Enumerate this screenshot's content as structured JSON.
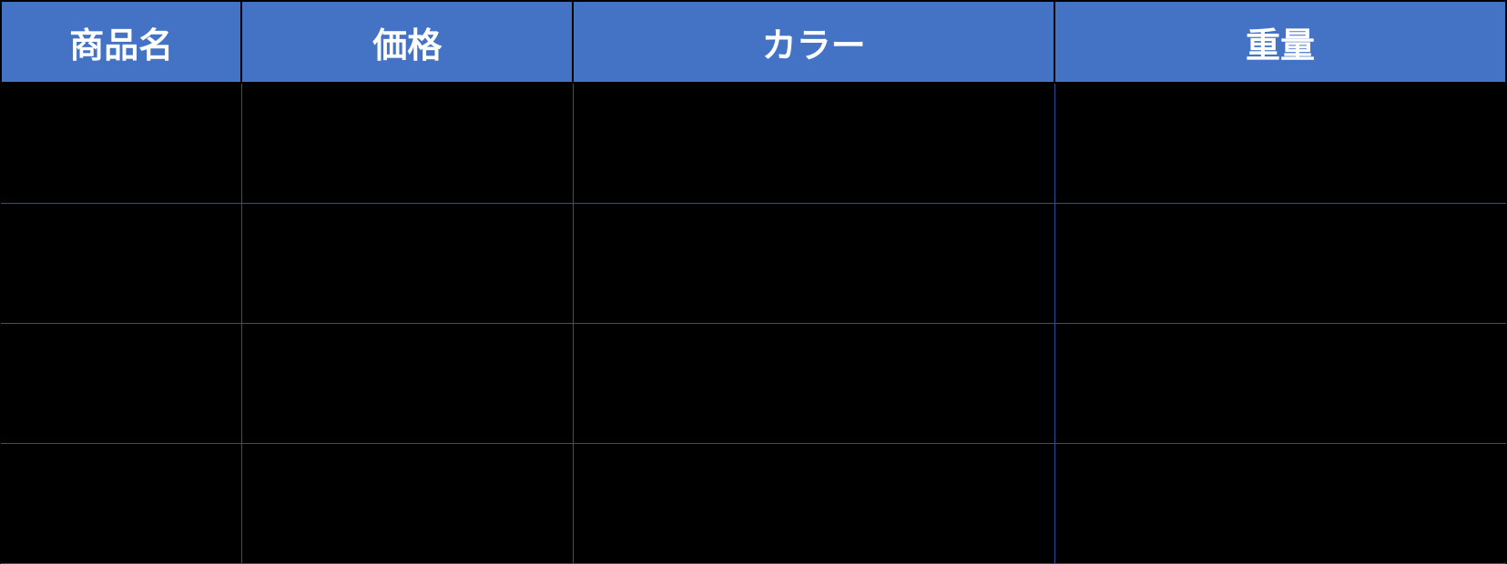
{
  "table": {
    "headers": [
      "商品名",
      "価格",
      "カラー",
      "重量"
    ],
    "rows": [
      [
        "",
        "",
        "",
        ""
      ],
      [
        "",
        "",
        "",
        ""
      ],
      [
        "",
        "",
        "",
        ""
      ],
      [
        "",
        "",
        "",
        ""
      ]
    ]
  }
}
